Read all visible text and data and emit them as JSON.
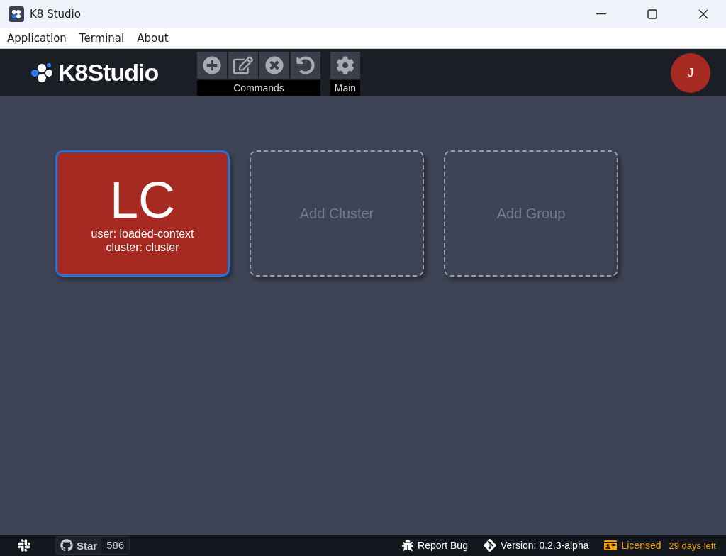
{
  "window": {
    "title": "K8 Studio"
  },
  "menu": [
    "Application",
    "Terminal",
    "About"
  ],
  "logo": {
    "text": "K8Studio"
  },
  "toolbar": [
    {
      "label": "Commands",
      "buttons": [
        {
          "kind": "add"
        },
        {
          "kind": "edit"
        },
        {
          "kind": "delete"
        },
        {
          "kind": "undo"
        }
      ]
    },
    {
      "label": "Main",
      "buttons": [
        {
          "kind": "settings"
        }
      ]
    }
  ],
  "avatar": {
    "initial": "J"
  },
  "cards": [
    {
      "kind": "cluster",
      "selected": true,
      "initials": "LC",
      "user": "user: loaded-context",
      "cluster": "cluster: cluster"
    },
    {
      "kind": "add",
      "selected": false,
      "label": "Add Cluster"
    },
    {
      "kind": "add",
      "selected": false,
      "label": "Add Group"
    }
  ],
  "status_bar": {
    "github": {
      "label": "Star",
      "count": "586"
    },
    "report": "Report Bug",
    "version": "Version: 0.2.3-alpha",
    "license": {
      "label": "Licensed",
      "days": "29 days left"
    }
  }
}
